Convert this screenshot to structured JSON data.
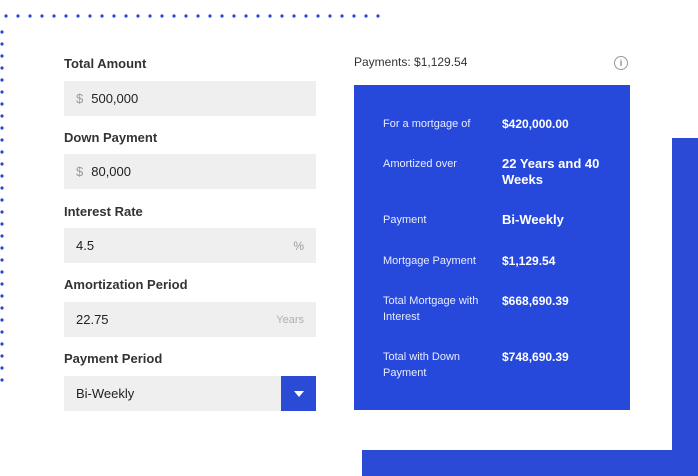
{
  "form": {
    "total_amount": {
      "label": "Total Amount",
      "prefix": "$",
      "value": "500,000"
    },
    "down_payment": {
      "label": "Down Payment",
      "prefix": "$",
      "value": "80,000"
    },
    "interest_rate": {
      "label": "Interest Rate",
      "value": "4.5",
      "suffix": "%"
    },
    "amortization_period": {
      "label": "Amortization Period",
      "value": "22.75",
      "suffix": "Years"
    },
    "payment_period": {
      "label": "Payment Period",
      "value": "Bi-Weekly"
    }
  },
  "results": {
    "title": "Payments: $1,129.54",
    "rows": [
      {
        "key": "For a mortgage of",
        "value": "$420,000.00"
      },
      {
        "key": "Amortized over",
        "value": "22 Years and 40 Weeks"
      },
      {
        "key": "Payment",
        "value": "Bi-Weekly"
      },
      {
        "key": "Mortgage Payment",
        "value": "$1,129.54"
      },
      {
        "key": "Total Mortgage with Interest",
        "value": "$668,690.39"
      },
      {
        "key": "Total with Down Payment",
        "value": "$748,690.39"
      }
    ]
  },
  "icons": {
    "info": "info-icon",
    "dropdown": "chevron-down-icon"
  },
  "colors": {
    "accent": "#2649dc",
    "field_bg": "#efefef"
  }
}
